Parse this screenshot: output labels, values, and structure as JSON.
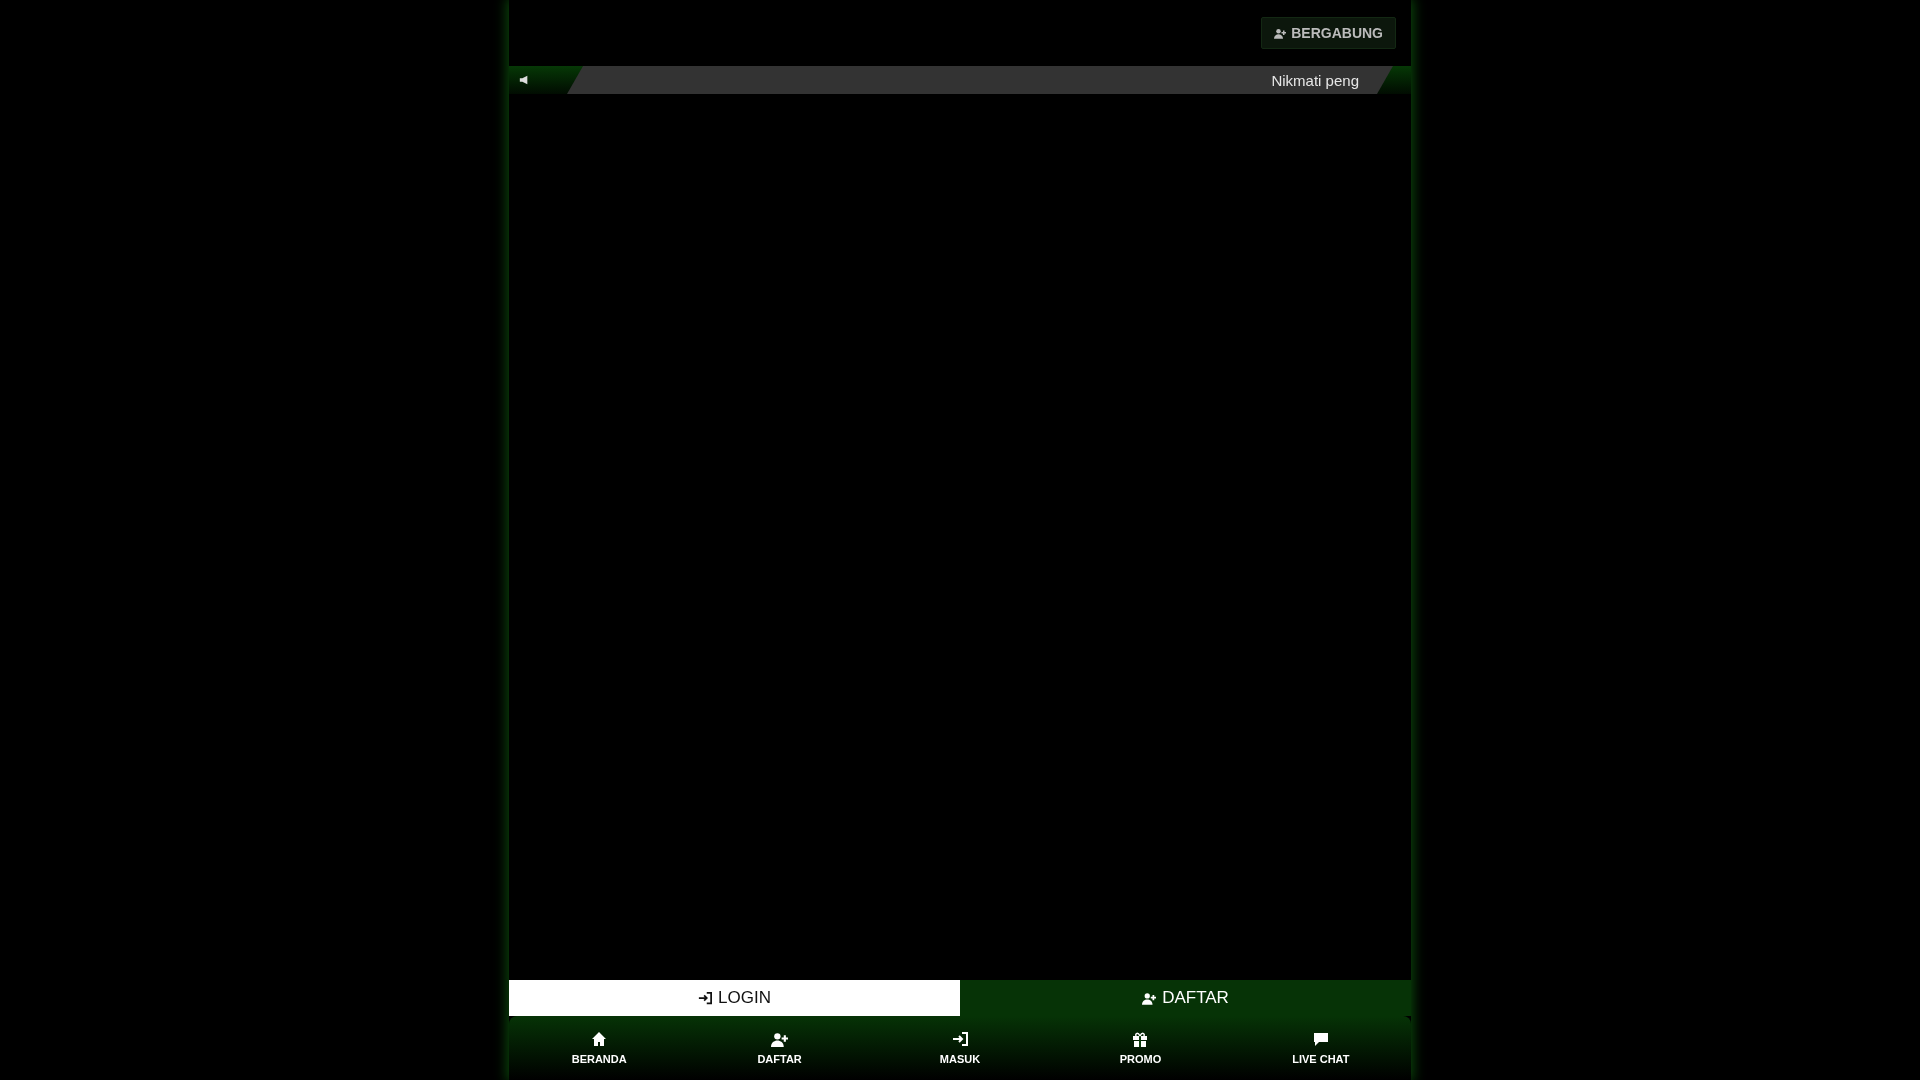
{
  "header": {
    "join_button": {
      "label": "BERGABUNG"
    }
  },
  "ticker": {
    "text": "Nikmati peng"
  },
  "auth_buttons": [
    {
      "label": "LOGIN",
      "kind": "light"
    },
    {
      "label": "DAFTAR",
      "kind": "dark"
    }
  ],
  "bottom_nav": [
    {
      "label": "BERANDA",
      "kind": "home"
    },
    {
      "label": "DAFTAR",
      "kind": "register"
    },
    {
      "label": "MASUK",
      "kind": "login"
    },
    {
      "label": "PROMO",
      "kind": "gift"
    },
    {
      "label": "LIVE CHAT",
      "kind": "chat"
    }
  ]
}
